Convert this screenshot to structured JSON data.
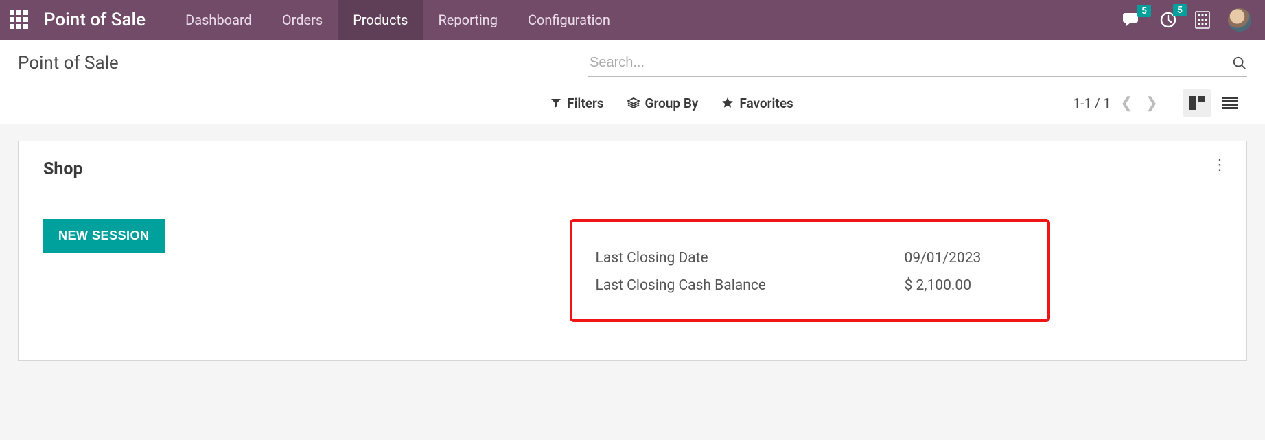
{
  "brand": "Point of Sale",
  "nav": {
    "dashboard": "Dashboard",
    "orders": "Orders",
    "products": "Products",
    "reporting": "Reporting",
    "configuration": "Configuration"
  },
  "badges": {
    "chat": "5",
    "clock": "5"
  },
  "breadcrumb": "Point of Sale",
  "search_placeholder": "Search...",
  "toolbar": {
    "filters": "Filters",
    "groupby": "Group By",
    "favorites": "Favorites",
    "pager": "1-1 / 1"
  },
  "card": {
    "title": "Shop",
    "new_session": "NEW SESSION",
    "last_closing_date_label": "Last Closing Date",
    "last_closing_date_value": "09/01/2023",
    "last_closing_balance_label": "Last Closing Cash Balance",
    "last_closing_balance_value": "$ 2,100.00"
  }
}
